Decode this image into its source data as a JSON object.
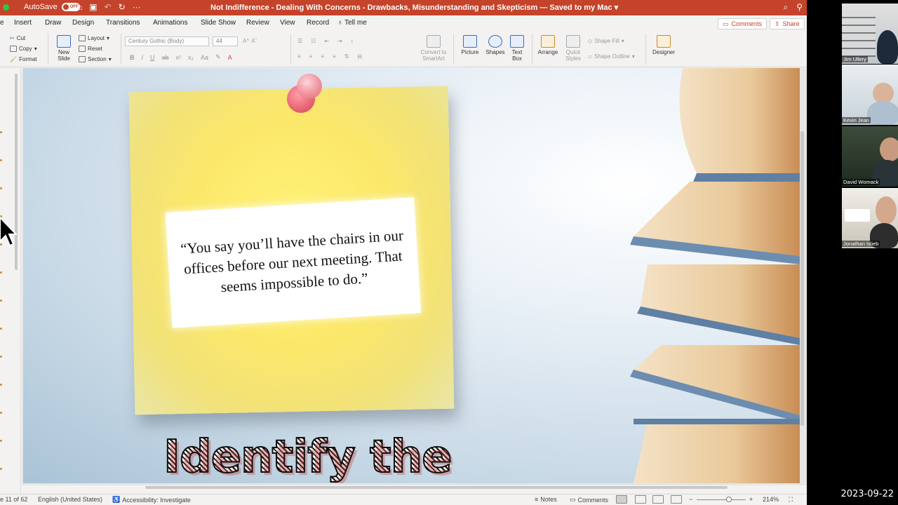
{
  "titlebar": {
    "autosave_label": "AutoSave",
    "autosave_state": "OFF",
    "document_title": "Not Indifference - Dealing With Concerns - Drawbacks, Misunderstanding and Skepticism — Saved to my Mac ▾"
  },
  "tabs": [
    "e",
    "Insert",
    "Draw",
    "Design",
    "Transitions",
    "Animations",
    "Slide Show",
    "Review",
    "View",
    "Record",
    "Tell me"
  ],
  "tabs_right": {
    "comments": "Comments",
    "share": "Share"
  },
  "ribbon": {
    "clipboard": {
      "cut": "Cut",
      "copy": "Copy",
      "format": "Format"
    },
    "slides": {
      "new_slide": "New\nSlide",
      "layout": "Layout",
      "reset": "Reset",
      "section": "Section"
    },
    "font_name": "Century Gothic (Body)",
    "font_size": "44",
    "convert": "Convert to\nSmartArt",
    "insert": {
      "picture": "Picture",
      "shapes": "Shapes",
      "text_box": "Text\nBox"
    },
    "arrange": "Arrange",
    "quick_styles": "Quick\nStyles",
    "shape_fill": "Shape Fill",
    "shape_outline": "Shape Outline",
    "designer": "Designer"
  },
  "slide": {
    "quote": "“You say you’ll have the chairs in our offices before our next meeting. That seems impossible to do.”",
    "caption": "Identify the"
  },
  "statusbar": {
    "slide_indicator": "e 11 of 62",
    "language": "English (United States)",
    "accessibility": "Accessibility: Investigate",
    "notes": "Notes",
    "comments": "Comments",
    "zoom": "214%"
  },
  "participants": [
    {
      "name": "Jim Ullery"
    },
    {
      "name": "Kevin Jean"
    },
    {
      "name": "David Womack"
    },
    {
      "name": "Jonathan Islieb"
    }
  ],
  "datestamp": "2023-09-22",
  "colors": {
    "accent": "#c4432a",
    "note": "#fbe86a"
  }
}
